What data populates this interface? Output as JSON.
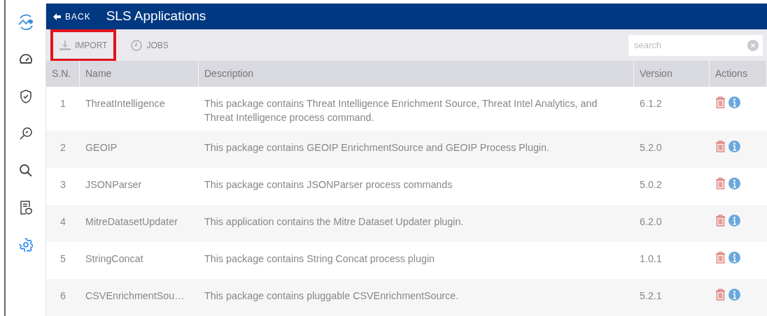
{
  "sidebar": {
    "items": [
      {
        "kind": "gauge",
        "selected": false
      },
      {
        "kind": "shield",
        "selected": false
      },
      {
        "kind": "inspect",
        "selected": false
      },
      {
        "kind": "search",
        "selected": false
      },
      {
        "kind": "report",
        "selected": false
      },
      {
        "kind": "gear",
        "selected": true
      }
    ]
  },
  "header": {
    "back_label": "BACK",
    "title": "SLS Applications"
  },
  "toolbar": {
    "buttons": [
      {
        "label": "IMPORT",
        "kind": "download",
        "highlighted": true
      },
      {
        "label": "JOBS",
        "kind": "clock",
        "highlighted": false
      }
    ],
    "search": {
      "placeholder": "search"
    }
  },
  "table": {
    "columns": [
      "S.N.",
      "Name",
      "Description",
      "Version",
      "Actions"
    ],
    "rows": [
      {
        "sn": "1",
        "name": "ThreatIntelligence",
        "description": "This package contains Threat Intelligence Enrichment Source, Threat Intel Analytics, and Threat Intelligence process command.",
        "version": "6.1.2"
      },
      {
        "sn": "2",
        "name": "GEOIP",
        "description": "This package contains GEOIP EnrichmentSource and GEOIP Process Plugin.",
        "version": "5.2.0"
      },
      {
        "sn": "3",
        "name": "JSONParser",
        "description": "This package contains JSONParser process commands",
        "version": "5.0.2"
      },
      {
        "sn": "4",
        "name": "MitreDatasetUpdater",
        "description": "This application contains the Mitre Dataset Updater plugin.",
        "version": "6.2.0"
      },
      {
        "sn": "5",
        "name": "StringConcat",
        "description": "This package contains String Concat process plugin",
        "version": "1.0.1"
      },
      {
        "sn": "6",
        "name": "CSVEnrichmentSou…",
        "description": "This package contains pluggable CSVEnrichmentSource.",
        "version": "5.2.1"
      }
    ]
  }
}
